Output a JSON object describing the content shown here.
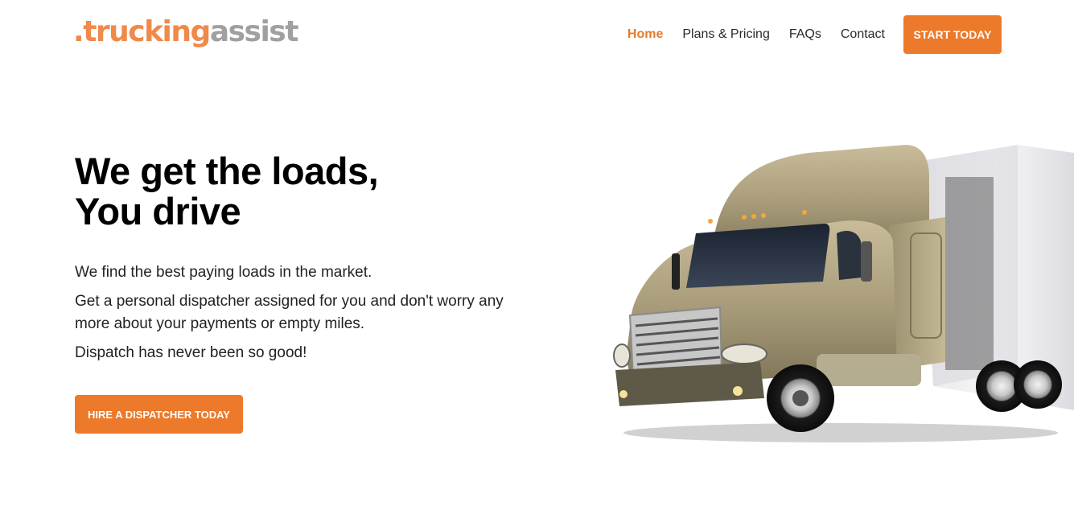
{
  "header": {
    "logo": {
      "dot": ".",
      "main": "trucking",
      "tail": "assist"
    },
    "nav": [
      {
        "label": "Home",
        "active": true
      },
      {
        "label": "Plans & Pricing",
        "active": false
      },
      {
        "label": "FAQs",
        "active": false
      },
      {
        "label": "Contact",
        "active": false
      }
    ],
    "cta_label": "START TODAY"
  },
  "hero": {
    "title_line1": "We get the loads,",
    "title_line2": "You drive",
    "paragraphs": [
      "We find the best paying loads in the market.",
      "Get a personal dispatcher assigned for you and don't worry any more about your payments or empty miles.",
      "Dispatch has never been so good!"
    ],
    "cta_label": "HIRE A DISPATCHER TODAY"
  },
  "colors": {
    "accent": "#ec7a2a",
    "logo_orange": "#f0894a",
    "logo_gray": "#a0a0a0",
    "text": "#222222"
  },
  "image": {
    "name": "semi-truck-image"
  }
}
